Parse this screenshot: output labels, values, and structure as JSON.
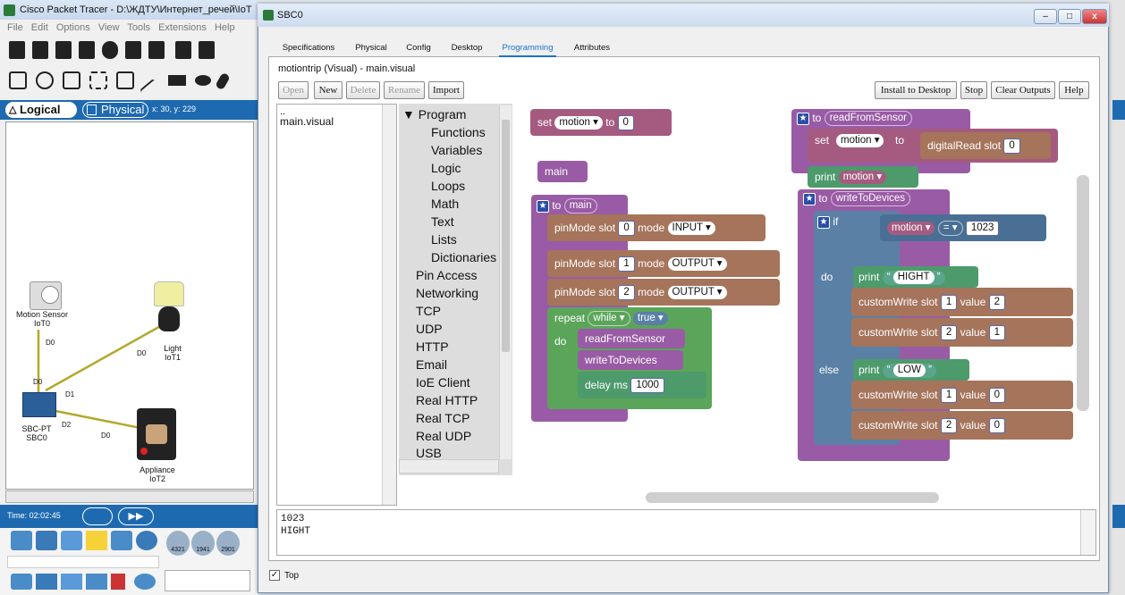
{
  "pt": {
    "title": "Cisco Packet Tracer - D:\\ЖДТУ\\Интернет_речей\\IoT",
    "menu": [
      "File",
      "Edit",
      "Options",
      "View",
      "Tools",
      "Extensions",
      "Help"
    ],
    "logical_tab": "Logical",
    "physical_tab": "Physical",
    "coords": "x: 30, y: 229",
    "time": "Time: 02:02:45",
    "devices": {
      "motion": {
        "name": "Motion Sensor",
        "id": "IoT0"
      },
      "light": {
        "name": "Light",
        "id": "IoT1"
      },
      "sbc": {
        "name": "SBC-PT",
        "id": "SBC0"
      },
      "appliance": {
        "name": "Appliance",
        "id": "IoT2"
      }
    },
    "ports": {
      "d0": "D0",
      "d1": "D1",
      "d2": "D2"
    },
    "router_labels": [
      "4321",
      "1941",
      "2901"
    ]
  },
  "dialog": {
    "title": "SBC0",
    "min": "–",
    "max": "□",
    "close": "x",
    "tabs": [
      "Specifications",
      "Physical",
      "Config",
      "Desktop",
      "Programming",
      "Attributes"
    ],
    "project_title": "motiontrip (Visual) - main.visual",
    "buttons": {
      "open": "Open",
      "new": "New",
      "delete": "Delete",
      "rename": "Rename",
      "import": "Import"
    },
    "right_buttons": {
      "install": "Install to Desktop",
      "stop": "Stop",
      "clear": "Clear Outputs",
      "help": "Help"
    },
    "files": [
      "..",
      "main.visual"
    ],
    "toolbox": {
      "program": "▼ Program",
      "items": [
        "Functions",
        "Variables",
        "Logic",
        "Loops",
        "Math",
        "Text",
        "Lists",
        "Dictionaries"
      ],
      "libs": [
        "Pin Access",
        "Networking",
        "TCP",
        "UDP",
        "HTTP",
        "Email",
        "IoE Client",
        "Real HTTP",
        "Real TCP",
        "Real UDP",
        "USB"
      ]
    },
    "output_text": "1023\nHIGHT",
    "top_label": "Top",
    "top_checked": "✓"
  },
  "blocks": {
    "set_top": {
      "set": "set",
      "var": "motion ▾",
      "to": "to",
      "val": "0"
    },
    "main_call": "main",
    "main_def": {
      "to": "to",
      "name": "main"
    },
    "pin1": {
      "fn": "pinMode",
      "slot": "slot",
      "slot_val": "0",
      "mode": "mode",
      "mode_val": "INPUT ▾"
    },
    "pin2": {
      "fn": "pinMode",
      "slot": "slot",
      "slot_val": "1",
      "mode": "mode",
      "mode_val": "OUTPUT ▾"
    },
    "pin3": {
      "fn": "pinMode",
      "slot": "slot",
      "slot_val": "2",
      "mode": "mode",
      "mode_val": "OUTPUT ▾"
    },
    "repeat": {
      "kw": "repeat",
      "mode": "while ▾",
      "cond": "true ▾",
      "do": "do"
    },
    "call_read": "readFromSensor",
    "call_write": "writeToDevices",
    "delay": {
      "fn": "delay",
      "unit": "ms",
      "val": "1000"
    },
    "read_def": {
      "to": "to",
      "name": "readFromSensor",
      "set": "set",
      "var": "motion ▾",
      "to2": "to",
      "fn": "digitalRead",
      "slot": "slot",
      "slot_val": "0",
      "print": "print",
      "print_var": "motion ▾"
    },
    "write_def": {
      "to": "to",
      "name": "writeToDevices",
      "if": "if",
      "var": "motion ▾",
      "op": "= ▾",
      "cmp": "1023",
      "do": "do",
      "else": "else",
      "print_do": "print",
      "str_do": "HIGHT",
      "print_else": "print",
      "str_else": "LOW",
      "cw": "customWrite",
      "slot": "slot",
      "value": "value",
      "w1": {
        "slot": "1",
        "val": "2"
      },
      "w2": {
        "slot": "2",
        "val": "1"
      },
      "w3": {
        "slot": "1",
        "val": "0"
      },
      "w4": {
        "slot": "2",
        "val": "0"
      }
    },
    "quote_open": "“",
    "quote_close": "”"
  },
  "colors": {
    "accent": "#1e6ab0",
    "variables": "#a55b80",
    "procedures": "#995ba5",
    "io": "#a5745b",
    "logic": "#5b80a5",
    "loops": "#5ba55b"
  }
}
